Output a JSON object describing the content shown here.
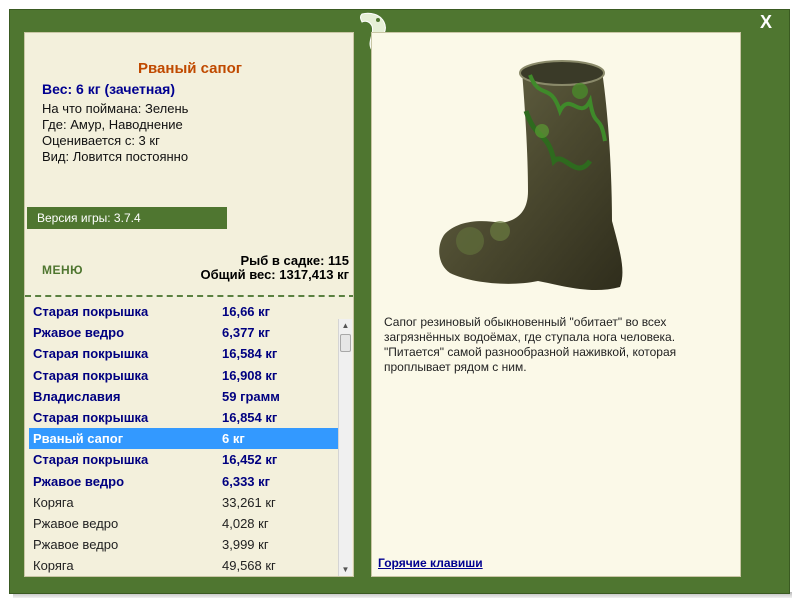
{
  "window": {
    "close_label": "X"
  },
  "fish": {
    "title": "Рваный сапог",
    "weight": "Вес: 6 кг (зачетная)",
    "caught_on": "На что поймана: Зелень",
    "where": "Где: Амур, Наводнение",
    "valued_from": "Оценивается с: 3 кг",
    "type": "Вид: Ловится постоянно"
  },
  "version": "Версия игры: 3.7.4",
  "menu_label": "МЕНЮ",
  "stats": {
    "fish_in_keepnet": "Рыб в садке: 115",
    "total_weight": "Общий вес: 1317,413 кг"
  },
  "catch_list": [
    {
      "name": "Старая покрышка",
      "weight": "16,66 кг",
      "style": "bold"
    },
    {
      "name": "Ржавое ведро",
      "weight": "6,377 кг",
      "style": "bold"
    },
    {
      "name": "Старая покрышка",
      "weight": "16,584 кг",
      "style": "bold"
    },
    {
      "name": "Старая покрышка",
      "weight": "16,908 кг",
      "style": "bold"
    },
    {
      "name": "Владиславия",
      "weight": "59 грамм",
      "style": "bold"
    },
    {
      "name": "Старая покрышка",
      "weight": "16,854 кг",
      "style": "bold"
    },
    {
      "name": "Рваный сапог",
      "weight": "6 кг",
      "style": "selected"
    },
    {
      "name": "Старая покрышка",
      "weight": "16,452 кг",
      "style": "bold"
    },
    {
      "name": "Ржавое ведро",
      "weight": "6,333 кг",
      "style": "bold"
    },
    {
      "name": "Коряга",
      "weight": "33,261 кг",
      "style": "normal"
    },
    {
      "name": "Ржавое ведро",
      "weight": "4,028 кг",
      "style": "normal"
    },
    {
      "name": "Ржавое ведро",
      "weight": "3,999 кг",
      "style": "normal"
    },
    {
      "name": "Коряга",
      "weight": "49,568 кг",
      "style": "normal"
    }
  ],
  "description": "Сапог резиновый обыкновенный \"обитает\" во всех загрязнённых водоёмах, где ступала нога человека. \"Питается\" самой разнообразной наживкой, которая проплывает рядом с ним.",
  "hotkeys_label": "Горячие клавиши",
  "colors": {
    "frame_green": "#4f7630",
    "panel_bg": "#f3f0dc",
    "title_orange": "#c04a00",
    "text_navy": "#000090",
    "selection_blue": "#3399ff"
  },
  "icons": {
    "logo": "frog-silhouette-logo",
    "close": "close-icon",
    "scroll_up": "arrow-up-icon",
    "scroll_down": "arrow-down-icon"
  }
}
